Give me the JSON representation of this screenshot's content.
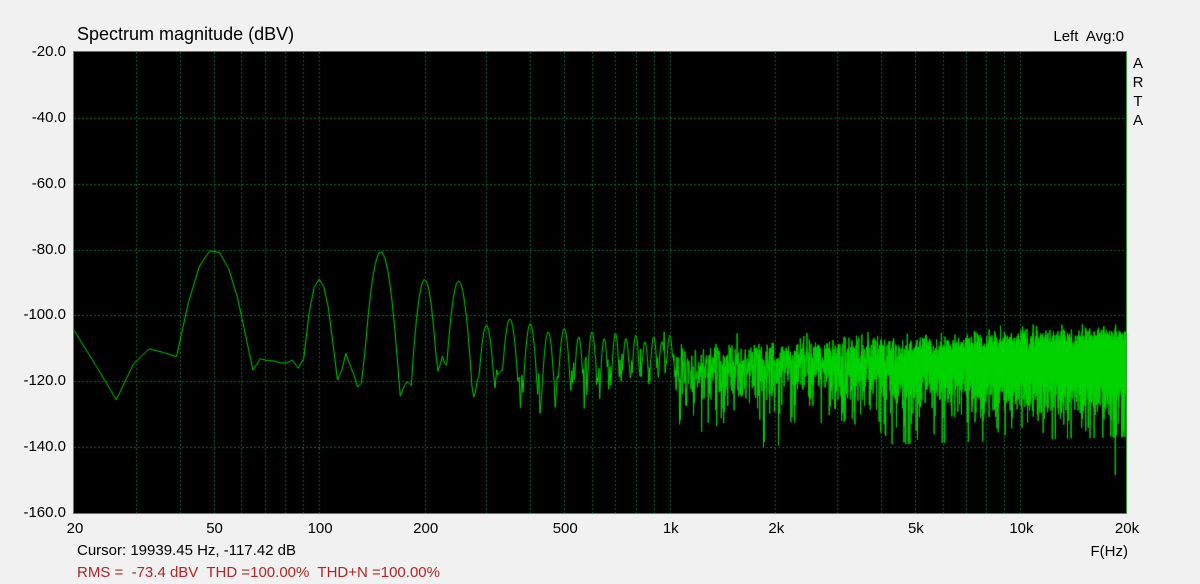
{
  "colors": {
    "background": "#f1f1f1",
    "plot_background": "#000000",
    "plot_border": "#2ea02e",
    "grid": "#006a2c",
    "trace": "#00d400",
    "text": "#000000",
    "rms_text": "#b42424"
  },
  "header": {
    "title": "Spectrum magnitude (dBV)",
    "avg_label": "Left  Avg:0"
  },
  "side_brand": "ARTA",
  "footer": {
    "f_label": "F(Hz)",
    "cursor_line": "Cursor: 19939.45 Hz, -117.42 dB",
    "rms_line": "RMS =  -73.4 dBV  THD =100.00%  THD+N =100.00%"
  },
  "cursor_readout": {
    "frequency_hz": 19939.45,
    "level_db": -117.42
  },
  "measurements": {
    "rms_dbv": -73.4,
    "thd_percent": 100.0,
    "thd_n_percent": 100.0
  },
  "chart_data": {
    "type": "line",
    "title": "Spectrum magnitude (dBV)",
    "xlabel": "F(Hz)",
    "ylabel": "dBV",
    "x_scale": "log",
    "xlim": [
      20,
      20000
    ],
    "ylim": [
      -160,
      -20
    ],
    "grid": true,
    "legend": "none",
    "series_name": "Left channel spectrum",
    "x_ticks": [
      {
        "f": 20,
        "label": "20"
      },
      {
        "f": 50,
        "label": "50"
      },
      {
        "f": 100,
        "label": "100"
      },
      {
        "f": 200,
        "label": "200"
      },
      {
        "f": 500,
        "label": "500"
      },
      {
        "f": 1000,
        "label": "1k"
      },
      {
        "f": 2000,
        "label": "2k"
      },
      {
        "f": 5000,
        "label": "5k"
      },
      {
        "f": 10000,
        "label": "10k"
      },
      {
        "f": 20000,
        "label": "20k"
      }
    ],
    "y_ticks": [
      {
        "db": -20,
        "label": "-20.0"
      },
      {
        "db": -40,
        "label": "-40.0"
      },
      {
        "db": -60,
        "label": "-60.0"
      },
      {
        "db": -80,
        "label": "-80.0"
      },
      {
        "db": -100,
        "label": "-100.0"
      },
      {
        "db": -120,
        "label": "-120.0"
      },
      {
        "db": -140,
        "label": "-140.0"
      },
      {
        "db": -160,
        "label": "-160.0"
      }
    ],
    "v_gridlines": [
      30,
      40,
      50,
      60,
      70,
      80,
      90,
      100,
      200,
      300,
      400,
      500,
      600,
      700,
      800,
      900,
      1000,
      2000,
      3000,
      4000,
      5000,
      6000,
      7000,
      8000,
      9000,
      10000
    ],
    "h_gridlines": [
      -40,
      -60,
      -80,
      -100,
      -120,
      -140
    ],
    "start_db": -104.5,
    "peaks": [
      {
        "f": 50,
        "db": -80.0,
        "w": 0.12
      },
      {
        "f": 100,
        "db": -89.0,
        "w": 0.06
      },
      {
        "f": 150,
        "db": -80.5,
        "w": 0.055
      },
      {
        "f": 200,
        "db": -89.0,
        "w": 0.045
      },
      {
        "f": 250,
        "db": -89.5,
        "w": 0.045
      },
      {
        "f": 300,
        "db": -103.0,
        "w": 0.035
      },
      {
        "f": 350,
        "db": -101.0,
        "w": 0.035
      },
      {
        "f": 400,
        "db": -102.5,
        "w": 0.03
      },
      {
        "f": 450,
        "db": -105.0,
        "w": 0.028
      },
      {
        "f": 500,
        "db": -104.0,
        "w": 0.028
      },
      {
        "f": 550,
        "db": -106.5,
        "w": 0.022
      },
      {
        "f": 600,
        "db": -105.0,
        "w": 0.022
      },
      {
        "f": 650,
        "db": -107.0,
        "w": 0.02
      },
      {
        "f": 700,
        "db": -105.5,
        "w": 0.02
      },
      {
        "f": 750,
        "db": -107.0,
        "w": 0.02
      },
      {
        "f": 800,
        "db": -106.0,
        "w": 0.02
      },
      {
        "f": 850,
        "db": -108.0,
        "w": 0.02
      },
      {
        "f": 900,
        "db": -106.5,
        "w": 0.02
      },
      {
        "f": 950,
        "db": -108.0,
        "w": 0.02
      },
      {
        "f": 1000,
        "db": -106.0,
        "w": 0.02
      }
    ],
    "null_spike": {
      "f": 18640,
      "db": -148.5
    },
    "noise": {
      "seed": 1337,
      "df_hz": 3.2,
      "skirt_drop_db": 45,
      "baseline": [
        [
          20,
          -104.5
        ],
        [
          23,
          -114
        ],
        [
          26.5,
          -126.5
        ],
        [
          29,
          -117
        ],
        [
          31,
          -110
        ],
        [
          35,
          -110
        ],
        [
          38,
          -113
        ],
        [
          44,
          -111
        ],
        [
          55,
          -116
        ],
        [
          62,
          -118
        ],
        [
          69,
          -113
        ],
        [
          73,
          -114.5
        ],
        [
          77,
          -115
        ],
        [
          83,
          -112
        ],
        [
          90,
          -117.5
        ],
        [
          97,
          -115
        ],
        [
          104,
          -119
        ],
        [
          112,
          -121
        ],
        [
          120,
          -111
        ],
        [
          126,
          -119
        ],
        [
          133,
          -121
        ],
        [
          142,
          -117
        ],
        [
          155,
          -119
        ],
        [
          166,
          -126.5
        ],
        [
          178,
          -121
        ],
        [
          195,
          -119
        ],
        [
          215,
          -119.5
        ],
        [
          225,
          -112.5
        ],
        [
          235,
          -120
        ],
        [
          247,
          -119
        ],
        [
          258,
          -117
        ],
        [
          268,
          -121
        ],
        [
          276,
          -123.5
        ],
        [
          288,
          -120
        ],
        [
          300,
          -119
        ],
        [
          312,
          -126
        ],
        [
          326,
          -112.5
        ],
        [
          334,
          -120
        ],
        [
          345,
          -124
        ],
        [
          360,
          -119
        ],
        [
          375,
          -121
        ],
        [
          395,
          -119
        ],
        [
          420,
          -123
        ],
        [
          450,
          -119
        ],
        [
          480,
          -121
        ],
        [
          500,
          -118.5
        ],
        [
          700,
          -118
        ],
        [
          1000,
          -117
        ],
        [
          2000,
          -115.5
        ],
        [
          5000,
          -114.5
        ],
        [
          10000,
          -113.5
        ],
        [
          20000,
          -112.5
        ]
      ]
    }
  }
}
